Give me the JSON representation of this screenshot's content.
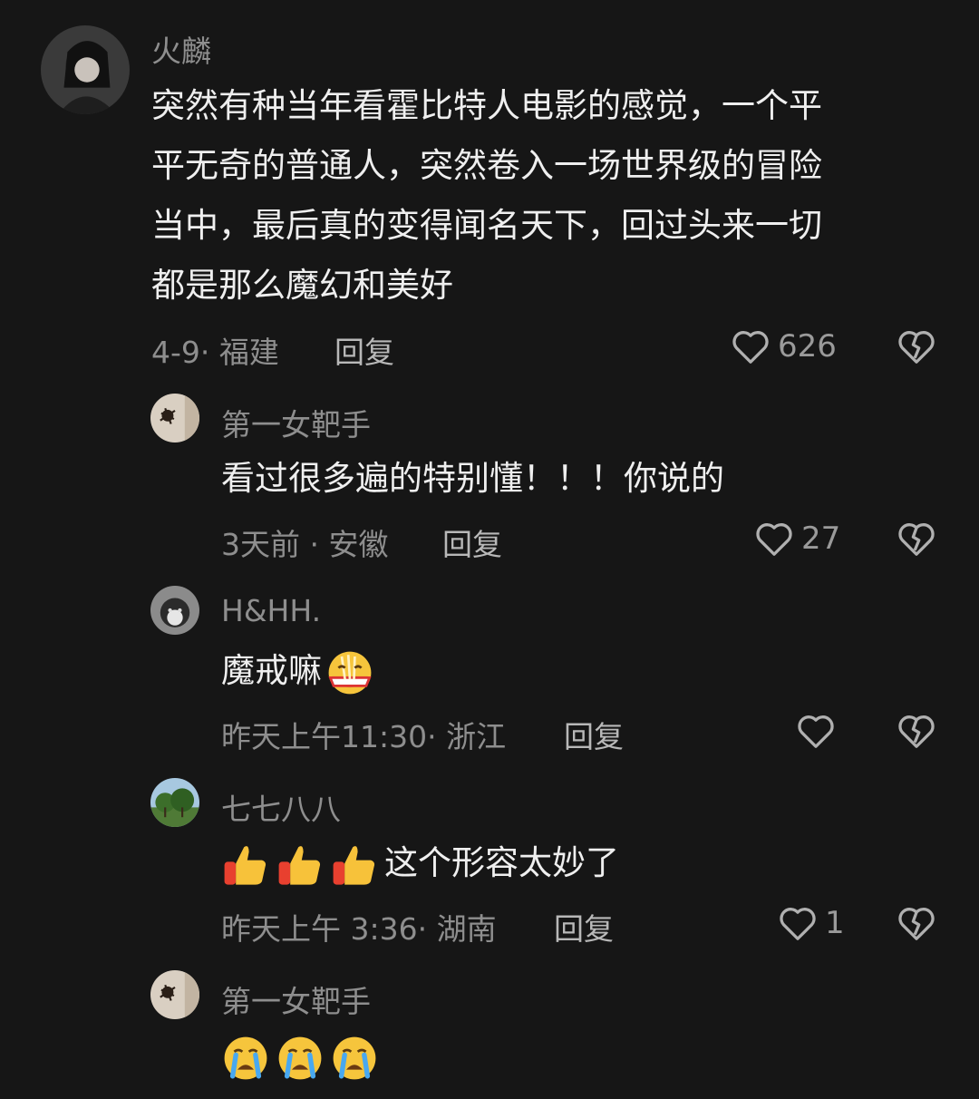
{
  "comments": [
    {
      "username": "火麟",
      "text_lines": [
        "突然有种当年看霍比特人电影的感觉，一个平",
        "平无奇的普通人，突然卷入一场世界级的冒险",
        "当中，最后真的变得闻名天下，回过头来一切",
        "都是那么魔幻和美好"
      ],
      "meta": "4-9· 福建",
      "reply": "回复",
      "likes": "626"
    },
    {
      "username": "第一女靶手",
      "text": "看过很多遍的特别懂！！！你说的",
      "meta": "3天前 · 安徽",
      "reply": "回复",
      "likes": "27"
    },
    {
      "username": "H&HH.",
      "text": "魔戒嘛",
      "meta": "昨天上午11:30· 浙江",
      "reply": "回复",
      "likes": ""
    },
    {
      "username": "七七八八",
      "text": "这个形容太妙了",
      "meta": "昨天上午 3:36· 湖南",
      "reply": "回复",
      "likes": "1"
    },
    {
      "username": "第一女靶手",
      "text": ""
    }
  ],
  "icons": {
    "like": "heart-outline-icon",
    "dislike": "broken-heart-icon",
    "emoji_thumbs": "thumbs-up-emoji",
    "emoji_cry": "crying-face-emoji",
    "emoji_yum": "noodle-emoji"
  }
}
